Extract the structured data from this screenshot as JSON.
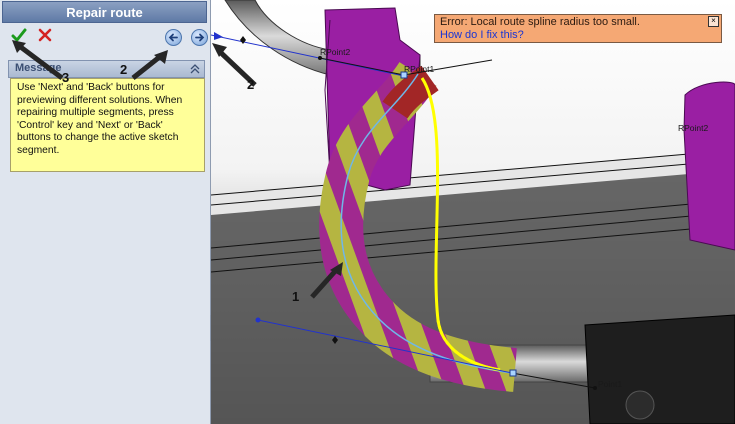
{
  "panel": {
    "title": "Repair route",
    "message_header": "Message",
    "message_text": "Use 'Next' and 'Back' buttons for previewing different solutions. When repairing multiple segments, press 'Control' key  and 'Next' or 'Back' buttons to change the active sketch segment."
  },
  "icons": {
    "ok": "green-check-icon",
    "cancel": "red-x-icon",
    "back": "back-arrow-icon",
    "next": "next-arrow-icon",
    "collapse": "double-chevron-up-icon"
  },
  "callouts": {
    "label_1": "1",
    "label_2a": "2",
    "label_2b": "2",
    "label_3": "3"
  },
  "error": {
    "text": "Error: Local route spline radius too small.",
    "help_link": "How do I fix this?",
    "close_glyph": "×"
  },
  "sketch_points": {
    "rpoint2_left": "RPoint2",
    "rpoint1_top": "RPoint1",
    "rpoint2_right": "RPoint2",
    "point1": "Point1"
  },
  "colors": {
    "tube_magenta": "#a0298f",
    "tube_yellow": "#b5b541",
    "clip_purple": "#9a1fa3",
    "error_bg": "#f5a874",
    "message_bg": "#ffff99",
    "spline_yellow": "#ffff00",
    "spline_blue": "#2233cc"
  }
}
